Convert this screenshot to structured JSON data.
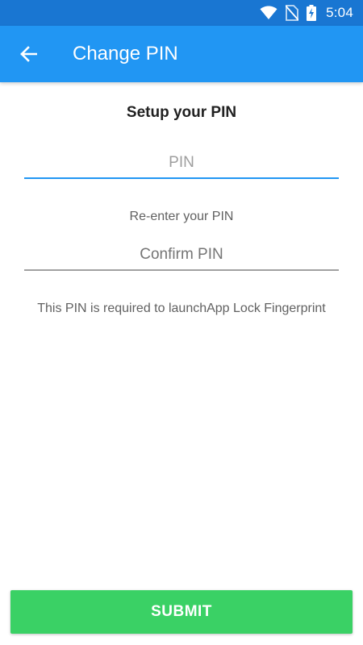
{
  "status_bar": {
    "time": "5:04",
    "icons": [
      "wifi-icon",
      "no-sim-icon",
      "battery-charging-icon"
    ]
  },
  "app_bar": {
    "title": "Change PIN",
    "back_icon": "arrow-back-icon",
    "background": "#2196f3",
    "status_background": "#1976d2"
  },
  "form": {
    "heading": "Setup your PIN",
    "pin": {
      "value": "",
      "placeholder": "PIN"
    },
    "reenter_label": "Re-enter your PIN",
    "confirm": {
      "value": "",
      "placeholder": "Confirm PIN"
    },
    "info": "This PIN is required to launchApp Lock Fingerprint"
  },
  "submit": {
    "label": "SUBMIT",
    "color": "#3ad165"
  },
  "colors": {
    "active_underline": "#2196f3",
    "inactive_underline": "#a0a0a0"
  }
}
